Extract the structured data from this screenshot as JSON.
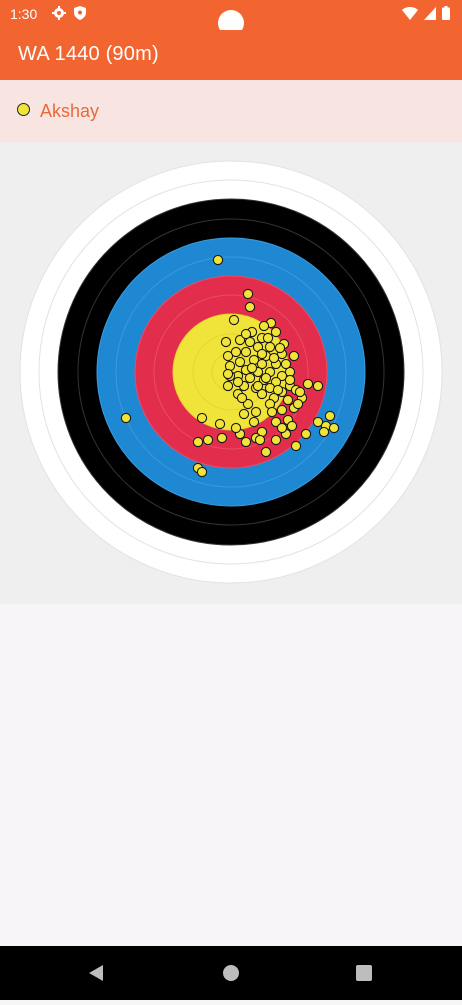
{
  "status_bar": {
    "time": "1:30",
    "left_icons": [
      "gear-icon",
      "shield-icon"
    ],
    "right_icons": [
      "wifi-icon",
      "signal-icon",
      "battery-icon"
    ]
  },
  "app_bar": {
    "title": "WA 1440 (90m)",
    "color": "#f26430"
  },
  "legend": {
    "archer_name": "Akshay",
    "dot_color": "#f0e33a"
  },
  "target": {
    "ring_colors": {
      "white": "#ffffff",
      "black": "#000000",
      "blue": "#1e88d2",
      "red": "#e22d4c",
      "gold": "#f0e33a"
    },
    "arrow_color": "#f0e33a"
  },
  "nav_bar": {
    "buttons": [
      "back-icon",
      "home-icon",
      "recents-icon"
    ]
  }
}
